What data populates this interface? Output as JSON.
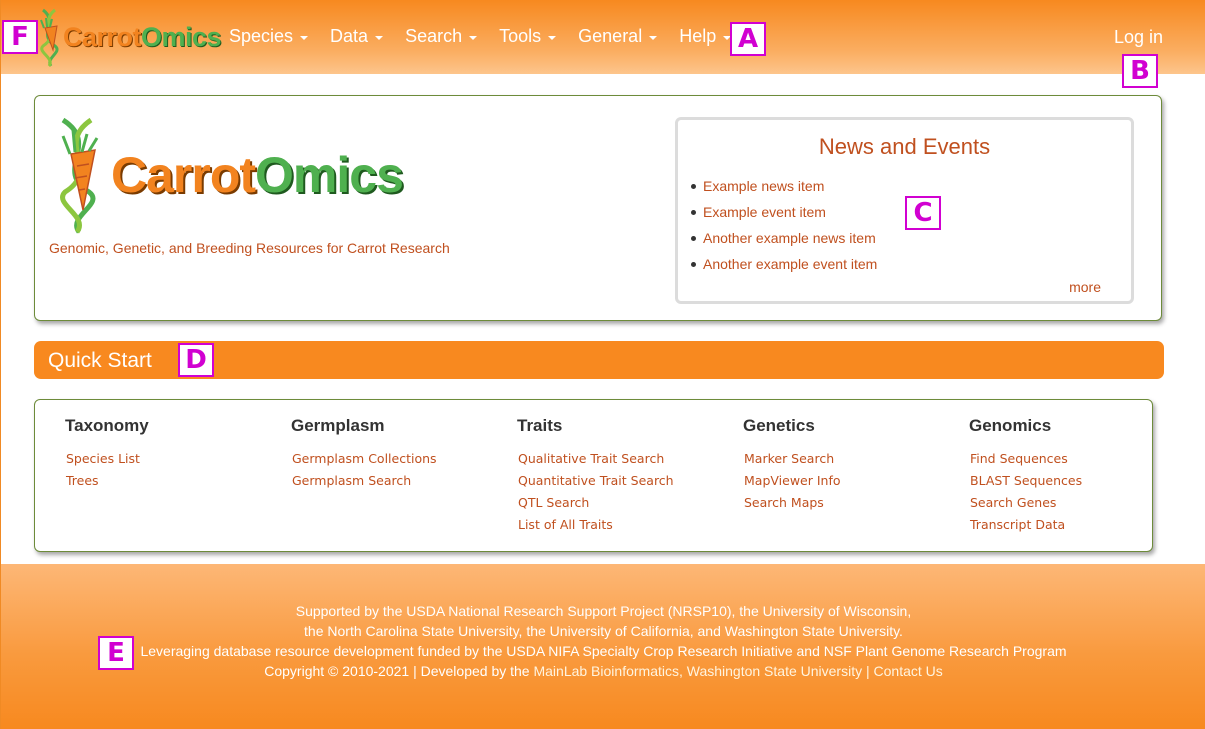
{
  "header": {
    "brand": {
      "part1": "Carrot",
      "part2": "Omics"
    },
    "nav": [
      {
        "label": "Species"
      },
      {
        "label": "Data"
      },
      {
        "label": "Search"
      },
      {
        "label": "Tools"
      },
      {
        "label": "General"
      },
      {
        "label": "Help"
      }
    ],
    "login_label": "Log in"
  },
  "markers": {
    "a": "A",
    "b": "B",
    "c": "C",
    "d": "D",
    "e": "E",
    "f": "F"
  },
  "hero": {
    "logo": {
      "part1": "Carrot",
      "part2": "Omics"
    },
    "tagline": "Genomic, Genetic, and Breeding Resources for Carrot Research"
  },
  "news": {
    "title": "News and Events",
    "items": [
      "Example news item",
      "Example event item",
      "Another example news item",
      "Another example event item"
    ],
    "more_label": "more"
  },
  "quick_start": {
    "title": "Quick Start",
    "columns": [
      {
        "heading": "Taxonomy",
        "links": [
          "Species List",
          "Trees"
        ]
      },
      {
        "heading": "Germplasm",
        "links": [
          "Germplasm Collections",
          "Germplasm Search"
        ]
      },
      {
        "heading": "Traits",
        "links": [
          "Qualitative Trait Search",
          "Quantitative Trait Search",
          "QTL Search",
          "List of All Traits"
        ]
      },
      {
        "heading": "Genetics",
        "links": [
          "Marker Search",
          "MapViewer Info",
          "Search Maps"
        ]
      },
      {
        "heading": "Genomics",
        "links": [
          "Find Sequences",
          "BLAST Sequences",
          "Search Genes",
          "Transcript Data"
        ]
      }
    ]
  },
  "footer": {
    "line1": "Supported by the USDA National Research Support Project (NRSP10), the University of Wisconsin,",
    "line2": "the North Carolina State University, the University of California, and Washington State University.",
    "line3": "Leveraging database resource development funded by the USDA NIFA Specialty Crop Research Initiative and NSF Plant Genome Research Program",
    "copyright": "Copyright © 2010-2021 | Developed by the",
    "mainlab_link": "MainLab Bioinformatics, Washington State University",
    "separator": "|",
    "contact_link": "Contact Us"
  },
  "colors": {
    "brand_orange": "#f8891f",
    "brand_green": "#4fb04f",
    "link": "#c0501f",
    "marker": "#d100d1"
  }
}
